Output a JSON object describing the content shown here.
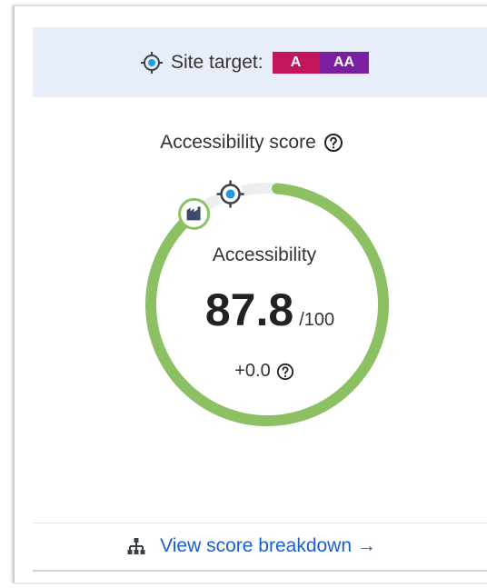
{
  "site_target": {
    "label": "Site target:",
    "badges": [
      "A",
      "AA"
    ],
    "icon": "crosshair-icon",
    "colors": {
      "a": "#c2185b",
      "aa": "#7b1fa2",
      "bar_bg": "#e8eef9"
    }
  },
  "score_section": {
    "title": "Accessibility score",
    "help_icon": "help-circle-icon"
  },
  "gauge": {
    "label": "Accessibility",
    "score": "87.8",
    "max": "/100",
    "score_fraction": 0.878,
    "target_fraction": 0.935,
    "change": "+0.0",
    "colors": {
      "progress": "#8cc063",
      "track": "#eeeeee"
    },
    "markers": [
      "target-crosshair-icon",
      "industry-benchmark-icon"
    ]
  },
  "footer": {
    "link_label": "View score breakdown →",
    "icon": "sitemap-icon",
    "link_color": "#1a5fd0"
  }
}
